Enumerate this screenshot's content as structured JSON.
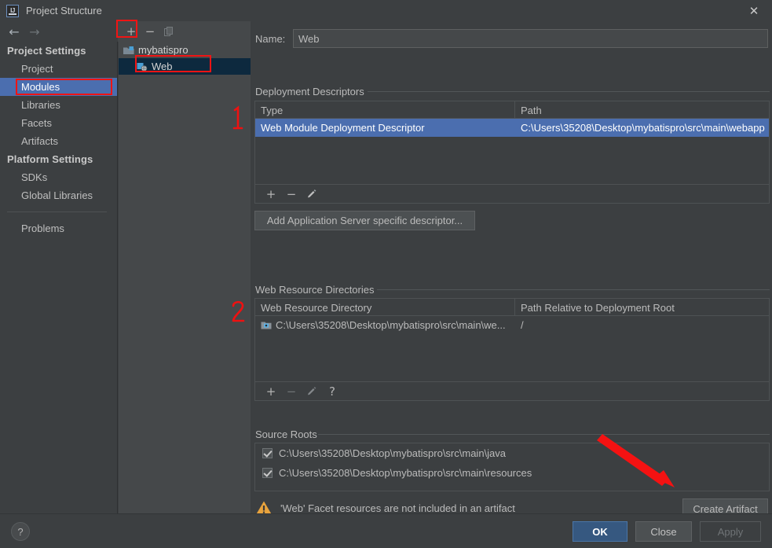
{
  "window": {
    "title": "Project Structure",
    "app_icon": "intellij-idea-logo",
    "close_label": "✕"
  },
  "nav": {
    "back_icon": "←",
    "forward_icon": "→"
  },
  "tree_toolbar": {
    "add_label": "+",
    "remove_label": "−",
    "copy_icon": "copy-icon"
  },
  "sidebar": {
    "groups": [
      {
        "title": "Project Settings"
      },
      {
        "title": "Platform Settings"
      }
    ],
    "items": [
      {
        "label": "Project",
        "selected": false
      },
      {
        "label": "Modules",
        "selected": true
      },
      {
        "label": "Libraries",
        "selected": false
      },
      {
        "label": "Facets",
        "selected": false
      },
      {
        "label": "Artifacts",
        "selected": false
      },
      {
        "label": "SDKs",
        "selected": false
      },
      {
        "label": "Global Libraries",
        "selected": false
      },
      {
        "label": "Problems",
        "selected": false
      }
    ]
  },
  "tree": {
    "nodes": [
      {
        "label": "mybatispro",
        "icon": "module-icon",
        "selected": false
      },
      {
        "label": "Web",
        "icon": "web-facet-icon",
        "selected": true
      }
    ]
  },
  "name_field": {
    "label": "Name:",
    "value": "Web",
    "placeholder": ""
  },
  "deployment_descriptors": {
    "section_title": "Deployment Descriptors",
    "columns": [
      "Type",
      "Path"
    ],
    "rows": [
      {
        "type": "Web Module Deployment Descriptor",
        "path": "C:\\Users\\35208\\Desktop\\mybatispro\\src\\main\\webapp",
        "selected": true
      }
    ],
    "toolbar": {
      "add": "+",
      "remove": "−",
      "edit": "edit-pencil-icon"
    },
    "add_server_descriptor_label": "Add Application Server specific descriptor..."
  },
  "web_resource_directories": {
    "section_title": "Web Resource Directories",
    "columns": [
      "Web Resource Directory",
      "Path Relative to Deployment Root"
    ],
    "rows": [
      {
        "directory": "C:\\Users\\35208\\Desktop\\mybatispro\\src\\main\\we...",
        "relative_path": "/"
      }
    ],
    "toolbar": {
      "add": "+",
      "remove": "−",
      "edit": "edit-pencil-icon",
      "help": "?"
    }
  },
  "source_roots": {
    "section_title": "Source Roots",
    "items": [
      {
        "path": "C:\\Users\\35208\\Desktop\\mybatispro\\src\\main\\java",
        "checked": true
      },
      {
        "path": "C:\\Users\\35208\\Desktop\\mybatispro\\src\\main\\resources",
        "checked": true
      }
    ]
  },
  "warning": {
    "icon": "warning-triangle-icon",
    "message": "'Web' Facet resources are not included in an artifact",
    "action_label": "Create Artifact"
  },
  "footer": {
    "help_label": "?",
    "ok_label": "OK",
    "close_label": "Close",
    "apply_label": "Apply"
  },
  "annotations": {
    "marker_1": "1",
    "marker_2": "2",
    "arrow": "red-arrow-pointing-to-create-artifact"
  },
  "colors": {
    "background": "#3c3f41",
    "panel": "#45484a",
    "selection_blue": "#4b6eaf",
    "tree_selection": "#0d293e",
    "primary_button": "#365880",
    "annotation_red": "#f01414",
    "warning_yellow": "#e8a33d"
  }
}
